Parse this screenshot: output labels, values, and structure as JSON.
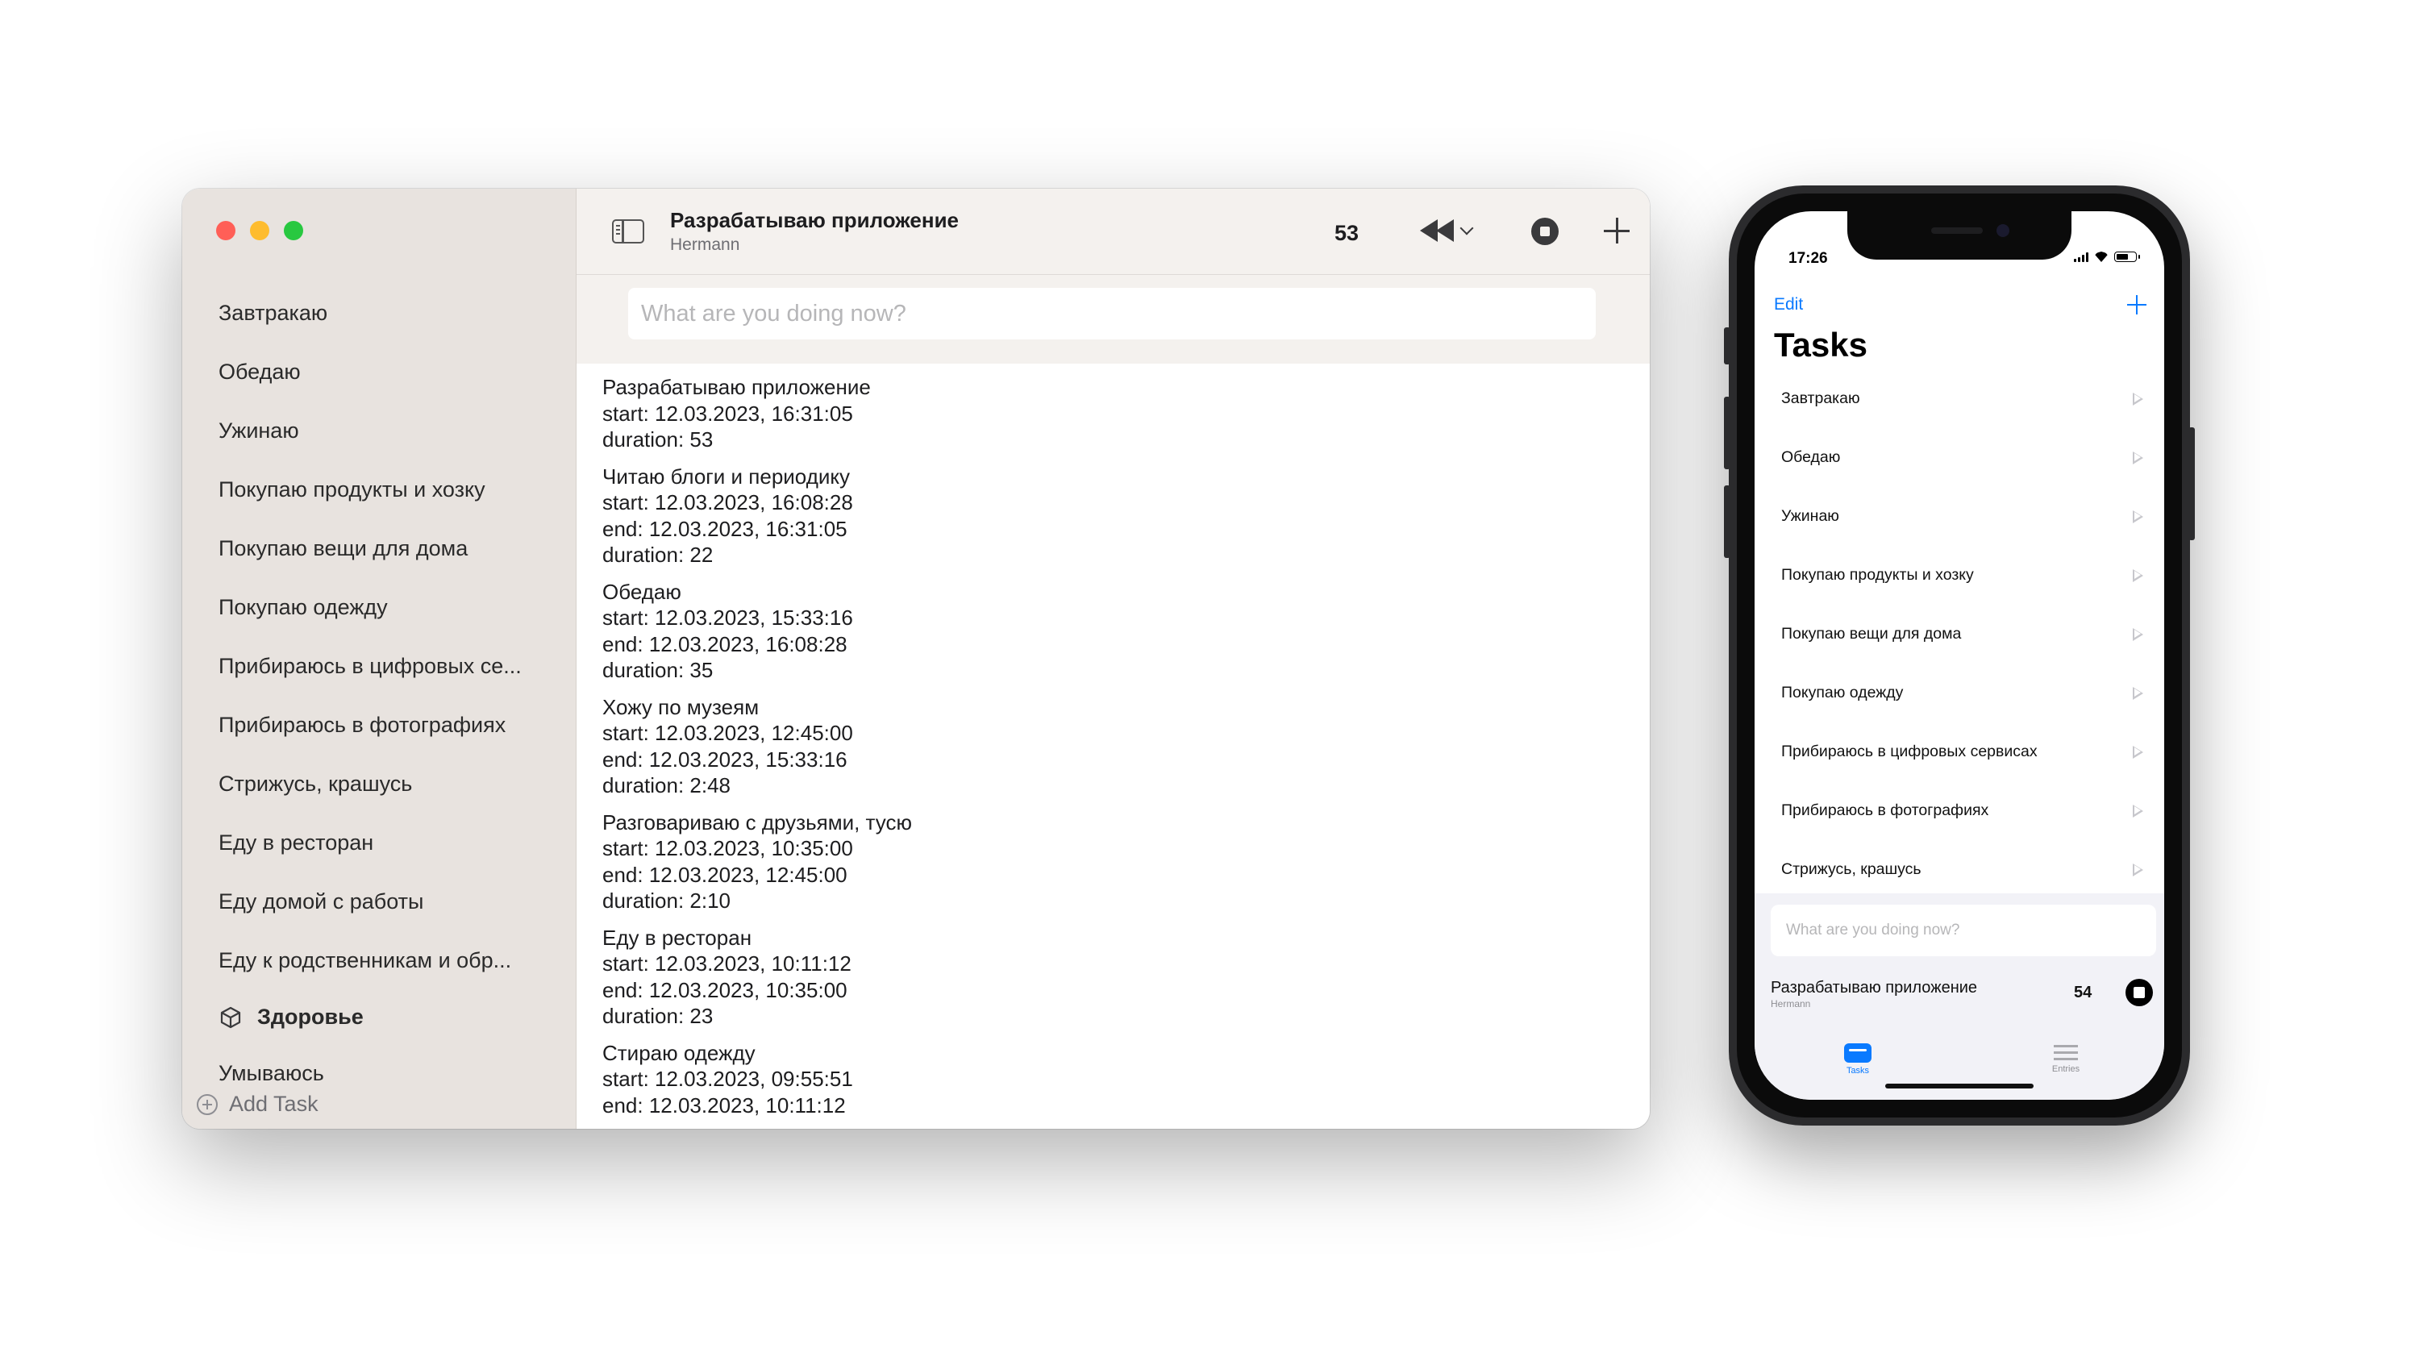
{
  "mac": {
    "sidebar": {
      "items": [
        "Завтракаю",
        "Обедаю",
        "Ужинаю",
        "Покупаю продукты и хозку",
        "Покупаю вещи для дома",
        "Покупаю одежду",
        "Прибираюсь в цифровых се...",
        "Прибираюсь в фотографиях",
        "Стрижусь, крашусь",
        "Еду в ресторан",
        "Еду домой с работы",
        "Еду к родственникам и обр..."
      ],
      "section_title": "Здоровье",
      "section_item": "Умываюсь",
      "add_task": "Add Task"
    },
    "toolbar": {
      "title": "Разрабатываю приложение",
      "subtitle": "Hermann",
      "count": "53"
    },
    "input_placeholder": "What are you doing now?",
    "entries": [
      [
        "Разрабатываю приложение",
        "start: 12.03.2023, 16:31:05",
        "duration: 53"
      ],
      [
        "Читаю блоги и периодику",
        "start: 12.03.2023, 16:08:28",
        "end: 12.03.2023, 16:31:05",
        "duration: 22"
      ],
      [
        "Обедаю",
        "start: 12.03.2023, 15:33:16",
        "end: 12.03.2023, 16:08:28",
        "duration: 35"
      ],
      [
        "Хожу по музеям",
        "start: 12.03.2023, 12:45:00",
        "end: 12.03.2023, 15:33:16",
        "duration: 2:48"
      ],
      [
        "Разговариваю с друзьями, тусю",
        "start: 12.03.2023, 10:35:00",
        "end: 12.03.2023, 12:45:00",
        "duration: 2:10"
      ],
      [
        "Еду в ресторан",
        "start: 12.03.2023, 10:11:12",
        "end: 12.03.2023, 10:35:00",
        "duration: 23"
      ],
      [
        "Стираю одежду",
        "start: 12.03.2023, 09:55:51",
        "end: 12.03.2023, 10:11:12"
      ]
    ]
  },
  "phone": {
    "time": "17:26",
    "edit": "Edit",
    "title": "Tasks",
    "items": [
      "Завтракаю",
      "Обедаю",
      "Ужинаю",
      "Покупаю продукты и хозку",
      "Покупаю вещи для дома",
      "Покупаю одежду",
      "Прибираюсь в цифровых сервисах",
      "Прибираюсь в фотографиях",
      "Стрижусь, крашусь"
    ],
    "input_placeholder": "What are you doing now?",
    "current": {
      "title": "Разрабатываю приложение",
      "subtitle": "Hermann",
      "count": "54"
    },
    "tabs": {
      "tasks": "Tasks",
      "entries": "Entries"
    },
    "accent_color": "#0a7aff"
  }
}
